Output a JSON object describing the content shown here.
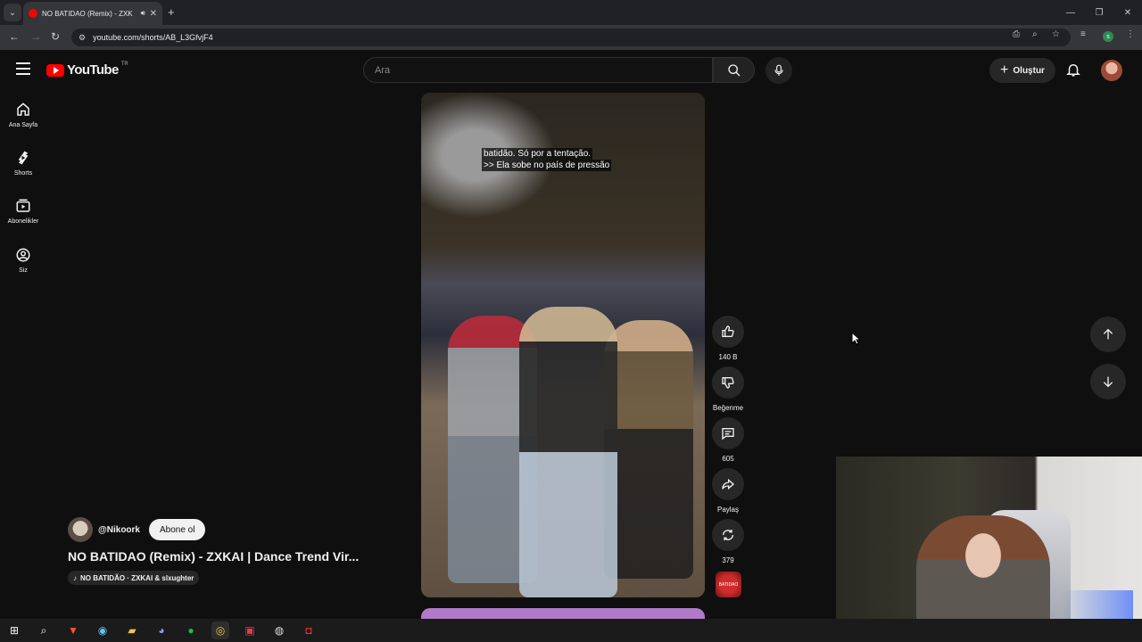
{
  "browser": {
    "tab_title": "NO BATIDAO (Remix) - ZXK",
    "url": "youtube.com/shorts/AB_L3GfvjF4",
    "profile_initial": "s"
  },
  "header": {
    "logo_text": "YouTube",
    "country_code": "TR",
    "search_placeholder": "Ara",
    "create_label": "Oluştur"
  },
  "sidebar": {
    "items": [
      {
        "label": "Ana Sayfa",
        "icon": "home-icon"
      },
      {
        "label": "Shorts",
        "icon": "shorts-icon"
      },
      {
        "label": "Abonelikler",
        "icon": "subscriptions-icon"
      },
      {
        "label": "Siz",
        "icon": "you-icon"
      }
    ]
  },
  "video": {
    "caption_line1": "batidão. Só por a tentação.",
    "caption_line2": ">> Ela sobe no país de pressão",
    "channel": "@Nikoork",
    "subscribe_label": "Abone ol",
    "title": "NO BATIDAO (Remix) - ZXKAI | Dance Trend Vir...",
    "music": "NO BATIDÃO · ZXKAI & slxughter"
  },
  "actions": {
    "like_count": "140 B",
    "dislike_label": "Beğenme",
    "comment_count": "605",
    "share_label": "Paylaş",
    "remix_count": "379",
    "sound_thumb_text": "BATIDAO"
  },
  "colors": {
    "brand_red": "#ff0000",
    "background": "#0f0f0f",
    "button_bg": "#272727"
  }
}
